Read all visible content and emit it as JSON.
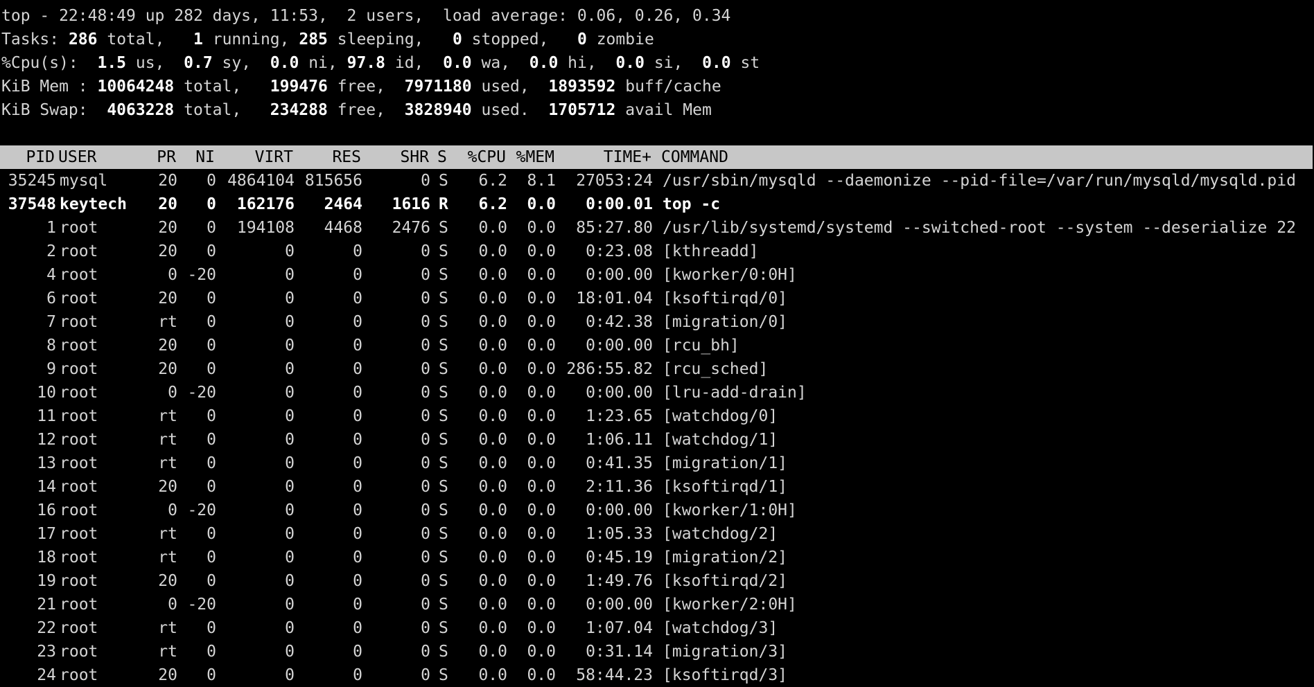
{
  "summary": {
    "uptime": {
      "prefix": "top - 22:48:49 up 282 days, 11:53,  2 users,  load average: 0.06, 0.26, 0.34"
    },
    "tasks": {
      "label": "Tasks:",
      "total": "286",
      "total_label": "total,",
      "running": "1",
      "running_label": "running,",
      "sleeping": "285",
      "sleeping_label": "sleeping,",
      "stopped": "0",
      "stopped_label": "stopped,",
      "zombie": "0",
      "zombie_label": "zombie"
    },
    "cpu": {
      "label": "%Cpu(s):",
      "us": "1.5",
      "us_label": "us,",
      "sy": "0.7",
      "sy_label": "sy,",
      "ni": "0.0",
      "ni_label": "ni,",
      "id": "97.8",
      "id_label": "id,",
      "wa": "0.0",
      "wa_label": "wa,",
      "hi": "0.0",
      "hi_label": "hi,",
      "si": "0.0",
      "si_label": "si,",
      "st": "0.0",
      "st_label": "st"
    },
    "mem": {
      "label": "KiB Mem :",
      "total": "10064248",
      "total_label": "total,",
      "free": "199476",
      "free_label": "free,",
      "used": "7971180",
      "used_label": "used,",
      "buff": "1893592",
      "buff_label": "buff/cache"
    },
    "swap": {
      "label": "KiB Swap:",
      "total": "4063228",
      "total_label": "total,",
      "free": "234288",
      "free_label": "free,",
      "used": "3828940",
      "used_label": "used.",
      "avail": "1705712",
      "avail_label": "avail Mem"
    }
  },
  "columns": {
    "pid": "PID",
    "user": "USER",
    "pr": "PR",
    "ni": "NI",
    "virt": "VIRT",
    "res": "RES",
    "shr": "SHR",
    "s": "S",
    "cpu": "%CPU",
    "mem": "%MEM",
    "time": "TIME+",
    "command": "COMMAND"
  },
  "processes": [
    {
      "pid": "35245",
      "user": "mysql",
      "pr": "20",
      "ni": "0",
      "virt": "4864104",
      "res": "815656",
      "shr": "0",
      "s": "S",
      "cpu": "6.2",
      "mem": "8.1",
      "time": "27053:24",
      "command": "/usr/sbin/mysqld --daemonize --pid-file=/var/run/mysqld/mysqld.pid"
    },
    {
      "pid": "37548",
      "user": "keytech",
      "pr": "20",
      "ni": "0",
      "virt": "162176",
      "res": "2464",
      "shr": "1616",
      "s": "R",
      "cpu": "6.2",
      "mem": "0.0",
      "time": "0:00.01",
      "command": "top -c"
    },
    {
      "pid": "1",
      "user": "root",
      "pr": "20",
      "ni": "0",
      "virt": "194108",
      "res": "4468",
      "shr": "2476",
      "s": "S",
      "cpu": "0.0",
      "mem": "0.0",
      "time": "85:27.80",
      "command": "/usr/lib/systemd/systemd --switched-root --system --deserialize 22"
    },
    {
      "pid": "2",
      "user": "root",
      "pr": "20",
      "ni": "0",
      "virt": "0",
      "res": "0",
      "shr": "0",
      "s": "S",
      "cpu": "0.0",
      "mem": "0.0",
      "time": "0:23.08",
      "command": "[kthreadd]"
    },
    {
      "pid": "4",
      "user": "root",
      "pr": "0",
      "ni": "-20",
      "virt": "0",
      "res": "0",
      "shr": "0",
      "s": "S",
      "cpu": "0.0",
      "mem": "0.0",
      "time": "0:00.00",
      "command": "[kworker/0:0H]"
    },
    {
      "pid": "6",
      "user": "root",
      "pr": "20",
      "ni": "0",
      "virt": "0",
      "res": "0",
      "shr": "0",
      "s": "S",
      "cpu": "0.0",
      "mem": "0.0",
      "time": "18:01.04",
      "command": "[ksoftirqd/0]"
    },
    {
      "pid": "7",
      "user": "root",
      "pr": "rt",
      "ni": "0",
      "virt": "0",
      "res": "0",
      "shr": "0",
      "s": "S",
      "cpu": "0.0",
      "mem": "0.0",
      "time": "0:42.38",
      "command": "[migration/0]"
    },
    {
      "pid": "8",
      "user": "root",
      "pr": "20",
      "ni": "0",
      "virt": "0",
      "res": "0",
      "shr": "0",
      "s": "S",
      "cpu": "0.0",
      "mem": "0.0",
      "time": "0:00.00",
      "command": "[rcu_bh]"
    },
    {
      "pid": "9",
      "user": "root",
      "pr": "20",
      "ni": "0",
      "virt": "0",
      "res": "0",
      "shr": "0",
      "s": "S",
      "cpu": "0.0",
      "mem": "0.0",
      "time": "286:55.82",
      "command": "[rcu_sched]"
    },
    {
      "pid": "10",
      "user": "root",
      "pr": "0",
      "ni": "-20",
      "virt": "0",
      "res": "0",
      "shr": "0",
      "s": "S",
      "cpu": "0.0",
      "mem": "0.0",
      "time": "0:00.00",
      "command": "[lru-add-drain]"
    },
    {
      "pid": "11",
      "user": "root",
      "pr": "rt",
      "ni": "0",
      "virt": "0",
      "res": "0",
      "shr": "0",
      "s": "S",
      "cpu": "0.0",
      "mem": "0.0",
      "time": "1:23.65",
      "command": "[watchdog/0]"
    },
    {
      "pid": "12",
      "user": "root",
      "pr": "rt",
      "ni": "0",
      "virt": "0",
      "res": "0",
      "shr": "0",
      "s": "S",
      "cpu": "0.0",
      "mem": "0.0",
      "time": "1:06.11",
      "command": "[watchdog/1]"
    },
    {
      "pid": "13",
      "user": "root",
      "pr": "rt",
      "ni": "0",
      "virt": "0",
      "res": "0",
      "shr": "0",
      "s": "S",
      "cpu": "0.0",
      "mem": "0.0",
      "time": "0:41.35",
      "command": "[migration/1]"
    },
    {
      "pid": "14",
      "user": "root",
      "pr": "20",
      "ni": "0",
      "virt": "0",
      "res": "0",
      "shr": "0",
      "s": "S",
      "cpu": "0.0",
      "mem": "0.0",
      "time": "2:11.36",
      "command": "[ksoftirqd/1]"
    },
    {
      "pid": "16",
      "user": "root",
      "pr": "0",
      "ni": "-20",
      "virt": "0",
      "res": "0",
      "shr": "0",
      "s": "S",
      "cpu": "0.0",
      "mem": "0.0",
      "time": "0:00.00",
      "command": "[kworker/1:0H]"
    },
    {
      "pid": "17",
      "user": "root",
      "pr": "rt",
      "ni": "0",
      "virt": "0",
      "res": "0",
      "shr": "0",
      "s": "S",
      "cpu": "0.0",
      "mem": "0.0",
      "time": "1:05.33",
      "command": "[watchdog/2]"
    },
    {
      "pid": "18",
      "user": "root",
      "pr": "rt",
      "ni": "0",
      "virt": "0",
      "res": "0",
      "shr": "0",
      "s": "S",
      "cpu": "0.0",
      "mem": "0.0",
      "time": "0:45.19",
      "command": "[migration/2]"
    },
    {
      "pid": "19",
      "user": "root",
      "pr": "20",
      "ni": "0",
      "virt": "0",
      "res": "0",
      "shr": "0",
      "s": "S",
      "cpu": "0.0",
      "mem": "0.0",
      "time": "1:49.76",
      "command": "[ksoftirqd/2]"
    },
    {
      "pid": "21",
      "user": "root",
      "pr": "0",
      "ni": "-20",
      "virt": "0",
      "res": "0",
      "shr": "0",
      "s": "S",
      "cpu": "0.0",
      "mem": "0.0",
      "time": "0:00.00",
      "command": "[kworker/2:0H]"
    },
    {
      "pid": "22",
      "user": "root",
      "pr": "rt",
      "ni": "0",
      "virt": "0",
      "res": "0",
      "shr": "0",
      "s": "S",
      "cpu": "0.0",
      "mem": "0.0",
      "time": "1:07.04",
      "command": "[watchdog/3]"
    },
    {
      "pid": "23",
      "user": "root",
      "pr": "rt",
      "ni": "0",
      "virt": "0",
      "res": "0",
      "shr": "0",
      "s": "S",
      "cpu": "0.0",
      "mem": "0.0",
      "time": "0:31.14",
      "command": "[migration/3]"
    },
    {
      "pid": "24",
      "user": "root",
      "pr": "20",
      "ni": "0",
      "virt": "0",
      "res": "0",
      "shr": "0",
      "s": "S",
      "cpu": "0.0",
      "mem": "0.0",
      "time": "58:44.23",
      "command": "[ksoftirqd/3]"
    }
  ],
  "highlight_pid": "37548",
  "colors": {
    "background": "#000000",
    "text": "#d4d4d4",
    "highlight_text": "#ffffff",
    "header_bg": "#c7c7c7",
    "header_text": "#000000"
  }
}
